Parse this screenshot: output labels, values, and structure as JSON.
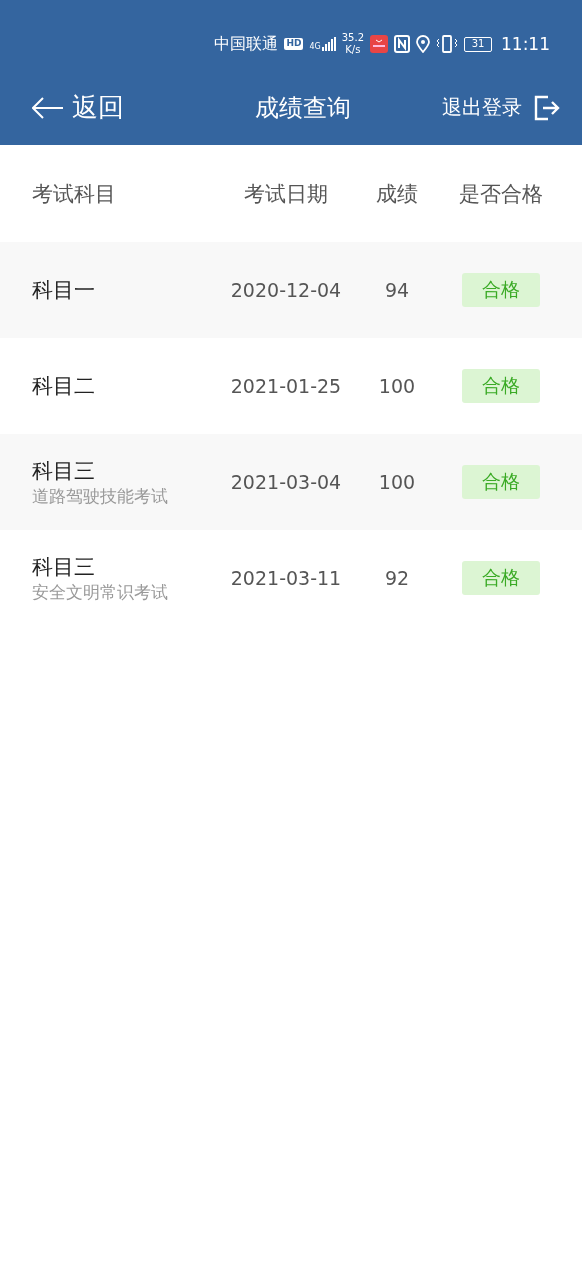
{
  "status_bar": {
    "carrier": "中国联通",
    "hd": "HD",
    "network": "4G",
    "speed_value": "35.2",
    "speed_unit": "K/s",
    "battery": "31",
    "time": "11:11"
  },
  "header": {
    "back": "返回",
    "title": "成绩查询",
    "logout": "退出登录"
  },
  "table": {
    "columns": [
      "考试科目",
      "考试日期",
      "成绩",
      "是否合格"
    ],
    "rows": [
      {
        "subject": "科目一",
        "date": "2020-12-04",
        "score": "94",
        "result": "合格",
        "passed": true
      },
      {
        "subject": "科目二",
        "date": "2021-01-25",
        "score": "100",
        "result": "合格",
        "passed": true
      },
      {
        "subject": "科目三",
        "detail": "道路驾驶技能考试",
        "date": "2021-03-04",
        "score": "100",
        "result": "合格",
        "passed": true
      },
      {
        "subject": "科目三",
        "detail": "安全文明常识考试",
        "date": "2021-03-11",
        "score": "92",
        "result": "合格",
        "passed": true
      }
    ]
  }
}
